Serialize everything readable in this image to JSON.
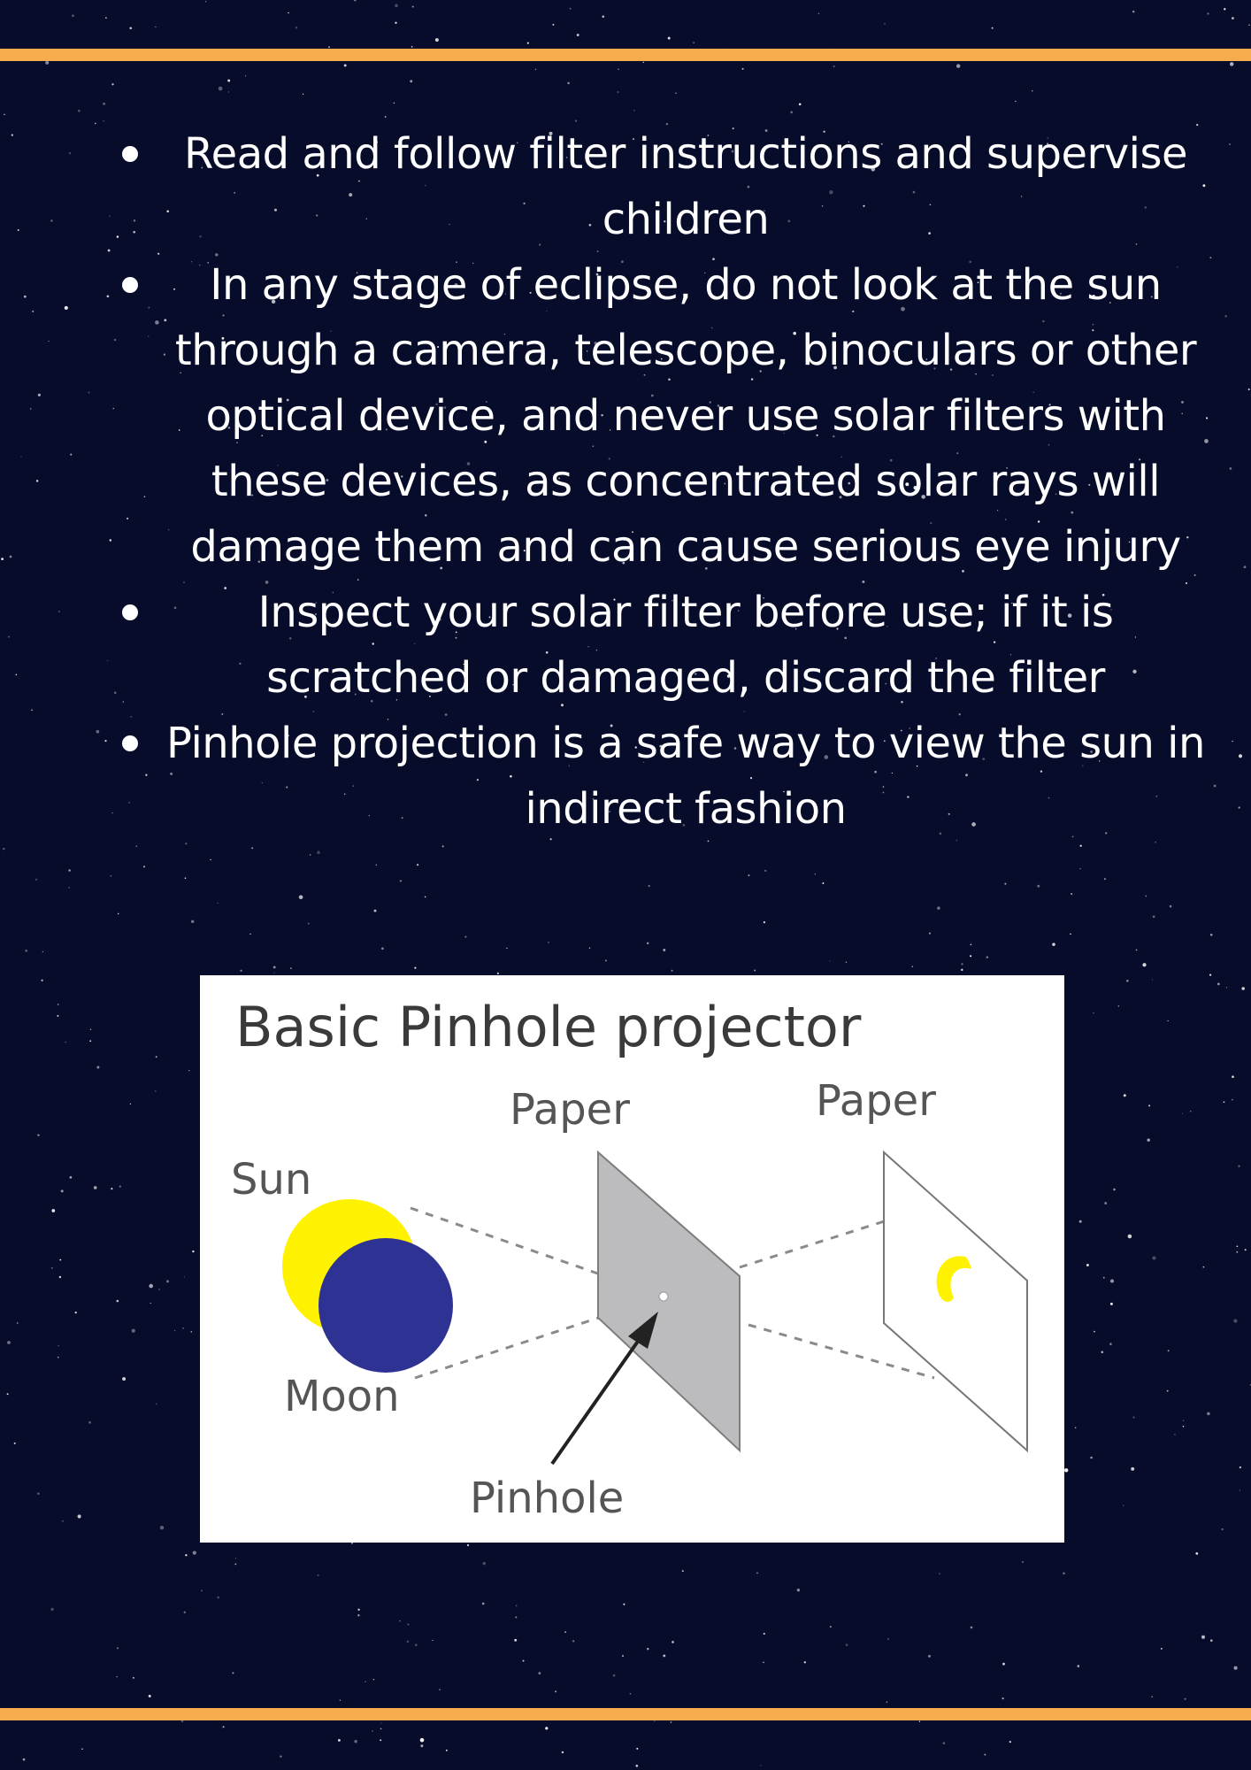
{
  "colors": {
    "background": "#070c2a",
    "accent_rule": "#f7ad4d",
    "text": "#ffffff",
    "sun": "#fff200",
    "moon": "#2e3393",
    "paper_gray": "#bcbcbe",
    "diagram_text": "#3a3a3a"
  },
  "tips": [
    {
      "text": "Read and follow filter instructions and supervise children"
    },
    {
      "text": "In any stage of eclipse, do not look at the sun through a camera, telescope, binoculars or other optical device, and never use solar filters with these devices, as concentrated solar rays will damage them and can cause serious eye injury"
    },
    {
      "text": "Inspect your solar filter before use; if it is scratched or damaged, discard the filter"
    },
    {
      "text": "Pinhole projection is a safe way to view the sun in indirect fashion"
    }
  ],
  "diagram": {
    "title": "Basic Pinhole projector",
    "label_sun": "Sun",
    "label_moon": "Moon",
    "label_paper_left": "Paper",
    "label_paper_right": "Paper",
    "label_pinhole": "Pinhole"
  }
}
